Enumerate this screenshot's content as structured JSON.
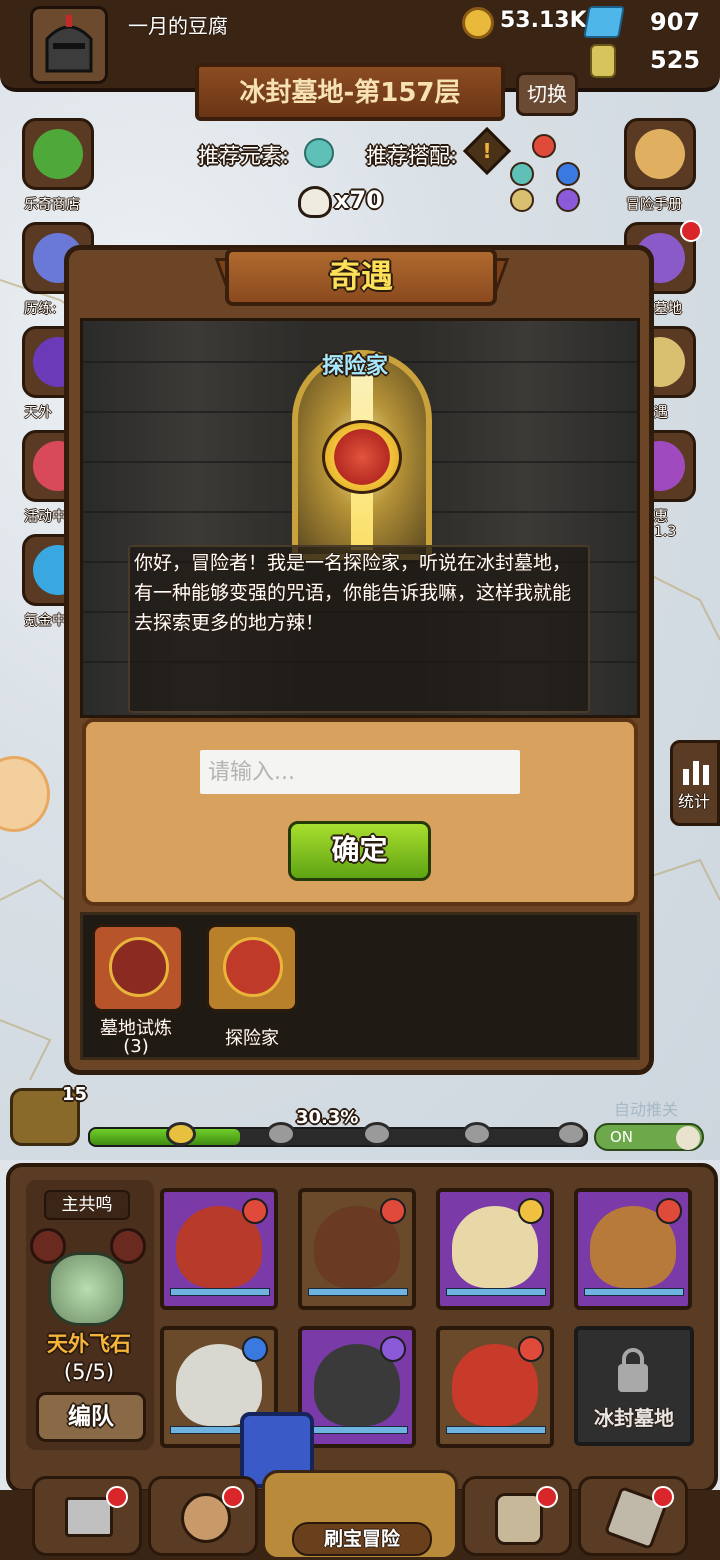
{
  "player": {
    "name": "一月的豆腐"
  },
  "currencies": {
    "gold": "53.13K",
    "gems": "907",
    "potions": "525"
  },
  "floor": {
    "title": "冰封墓地-第157层",
    "switch_label": "切换"
  },
  "recommend": {
    "element_label": "推荐元素:",
    "combo_label": "推荐搭配:",
    "combo_icon": "!"
  },
  "skull_count": "x70",
  "side_left": [
    {
      "label": "乐奇商店",
      "icon": "clover-icon",
      "color": "#4fa83a"
    },
    {
      "label": "历练:",
      "icon": "vase-icon",
      "color": "#6a78d8"
    },
    {
      "label": "天外",
      "icon": "portal-icon",
      "color": "#6a3ab8"
    },
    {
      "label": "活动中",
      "icon": "flower-icon",
      "color": "#d84a5a"
    },
    {
      "label": "氪金中",
      "icon": "diamond-icon",
      "color": "#3aa8e0"
    }
  ],
  "side_right": [
    {
      "label": "冒险手册",
      "icon": "scroll-icon",
      "color": "#e0b060"
    },
    {
      "label": "墓地",
      "icon": "chest-icon",
      "color": "#8a5ac8"
    },
    {
      "label": "遇",
      "icon": "map-icon",
      "color": "#d8c070"
    },
    {
      "label": "惠",
      "icon": "gift-icon",
      "color": "#a04ac0"
    }
  ],
  "side_right_sub": "1.3",
  "stats_label": "统计",
  "modal": {
    "title": "奇遇",
    "npc_name": "探险家",
    "dialog": "你好，冒险者！我是一名探险家，听说在冰封墓地，有一种能够变强的咒语，你能告诉我嘛，这样我就能去探索更多的地方辣！",
    "input_placeholder": "请输入...",
    "confirm_label": "确定",
    "events": [
      {
        "label": "墓地试炼",
        "count": "(3)",
        "bg": "#b8542a",
        "emblem": "#8a2a20"
      },
      {
        "label": "探险家",
        "count": "",
        "bg": "#b8802a",
        "emblem": "#c03a2a"
      }
    ]
  },
  "progress": {
    "chest_count": "15",
    "percent_label": "30.3%",
    "percent": 30.3,
    "auto_label": "自动推关",
    "auto_state": "ON"
  },
  "team": {
    "resonance": "主共鸣",
    "stone_name": "天外飞石",
    "stone_count": "(5/5)",
    "team_button": "编队",
    "locked_label": "冰封墓地"
  },
  "heroes": [
    {
      "name": "demon-hero",
      "face": "#b83a2a",
      "elem": "#e04a3a",
      "border": "#7a3aa8"
    },
    {
      "name": "burnt-hero",
      "face": "#6a3a22",
      "elem": "#e04a3a",
      "border": "#6a4a2a"
    },
    {
      "name": "king-hero",
      "face": "#e8d8a8",
      "elem": "#f0c040",
      "border": "#7a3aa8"
    },
    {
      "name": "turban-hero",
      "face": "#b87a3a",
      "elem": "#e04a3a",
      "border": "#7a3aa8"
    },
    {
      "name": "girl-hero",
      "face": "#d8d8d0",
      "elem": "#3a7ae0",
      "border": "#6a4a2a"
    },
    {
      "name": "ninja-hero",
      "face": "#3a3a3a",
      "elem": "#8a5ad8",
      "border": "#7a3aa8"
    },
    {
      "name": "imp-hero",
      "face": "#c83a2a",
      "elem": "#e04a3a",
      "border": "#6a4a2a"
    }
  ],
  "nav": {
    "adventure_label": "刷宝冒险"
  },
  "colors": {
    "accent_yellow": "#fbe058",
    "confirm_green": "#7bc01e",
    "panel_brown": "#6b4526",
    "progress_green": "#5fb11a"
  }
}
